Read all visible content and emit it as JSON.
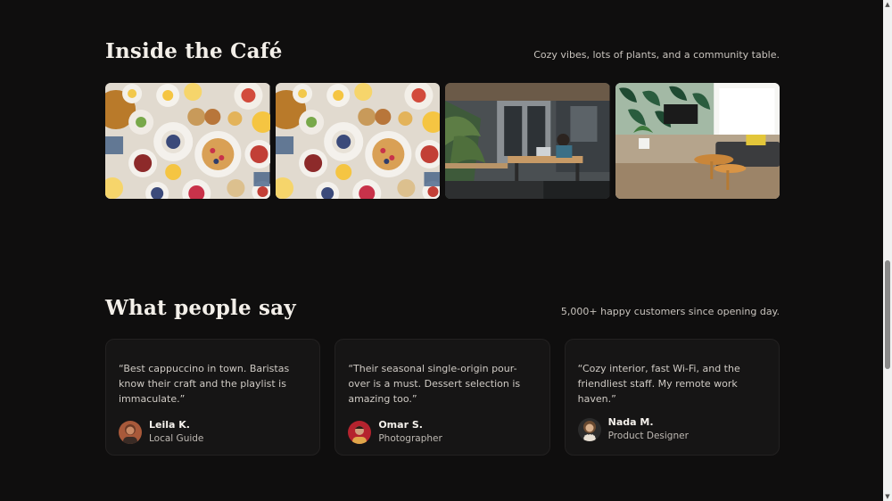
{
  "gallery": {
    "title": "Inside the Café",
    "subtitle": "Cozy vibes, lots of plants, and a community table.",
    "photos": [
      {
        "icon": "brunch-table-photo"
      },
      {
        "icon": "brunch-table-photo"
      },
      {
        "icon": "cafe-workspace-photo"
      },
      {
        "icon": "lounge-interior-photo"
      }
    ]
  },
  "testimonials": {
    "title": "What people say",
    "subtitle": "5,000+ happy customers since opening day.",
    "items": [
      {
        "quote": "“Best cappuccino in town. Baristas know their craft and the playlist is immaculate.”",
        "name": "Leila K.",
        "role": "Local Guide"
      },
      {
        "quote": "“Their seasonal single-origin pour-over is a must. Dessert selection is amazing too.”",
        "name": "Omar S.",
        "role": "Photographer"
      },
      {
        "quote": "“Cozy interior, fast Wi-Fi, and the friendliest staff. My remote work haven.”",
        "name": "Nada M.",
        "role": "Product Designer"
      }
    ]
  },
  "colors": {
    "background": "#0f0e0e",
    "card": "#161515",
    "text": "#f3efe9"
  }
}
